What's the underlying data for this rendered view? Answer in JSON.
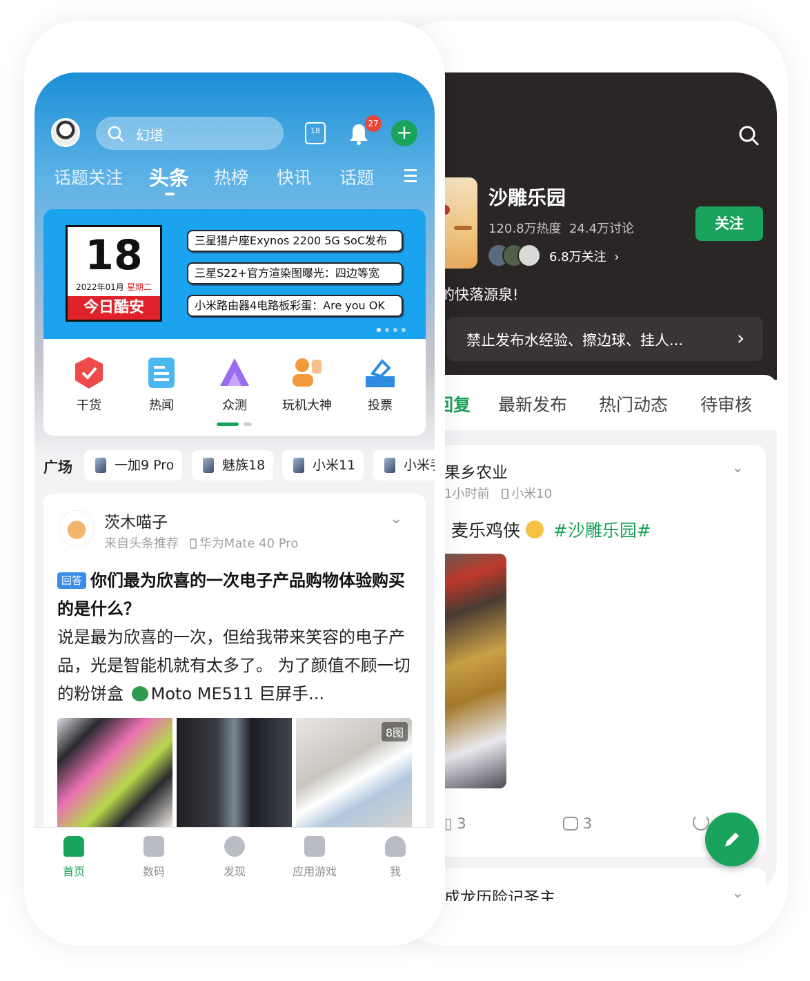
{
  "front": {
    "search_placeholder": "幻塔",
    "notification_badge": "27",
    "calendar_icon_day": "18",
    "tabs": [
      "话题关注",
      "头条",
      "热榜",
      "快讯",
      "话题"
    ],
    "banner": {
      "day": "18",
      "date": "2022年01月",
      "weekday": "星期二",
      "brand": "今日酷安",
      "headlines": [
        "三星猎户座Exynos 2200 5G SoC发布",
        "三星S22+官方渲染图曝光：四边等宽",
        "小米路由器4电路板彩蛋：Are you OK"
      ]
    },
    "quick_entries": [
      "干货",
      "热闻",
      "众测",
      "玩机大神",
      "投票"
    ],
    "square_label": "广场",
    "square_chips": [
      "一加9 Pro",
      "魅族18",
      "小米11",
      "小米手"
    ],
    "post": {
      "author": "茨木喵子",
      "source": "来自头条推荐",
      "device": "华为Mate 40 Pro",
      "tag": "回答",
      "title": "你们最为欣喜的一次电子产品购物体验购买的是什么？",
      "body": "说是最为欣喜的一次，但给我带来笑容的电子产品，光是智能机就有太多了。 为了颜值不顾一切的粉饼盒",
      "body_tail": "Moto ME511 巨屏手...",
      "image_count": "8图"
    },
    "bottom_nav": [
      "首页",
      "数码",
      "发现",
      "应用游戏",
      "我"
    ],
    "colors": {
      "accent": "#1aa35a",
      "banner_blue": "#1aa3ef",
      "tag_blue": "#3a8ee6"
    }
  },
  "back": {
    "group_name": "沙雕乐园",
    "stats": "120.8万热度  24.4万讨论",
    "followers": "6.8万关注",
    "follow_button": "关注",
    "slogan": "的快落源泉!",
    "notice": "禁止发布水经验、擦边球、挂人...",
    "tabs": [
      "回复",
      "最新发布",
      "热门动态",
      "待审核"
    ],
    "post": {
      "author": "果乡农业",
      "time": "1小时前",
      "device": "小米10",
      "text": "麦乐鸡侠",
      "hashtag": "#沙雕乐园#",
      "likes": "3",
      "comments": "3"
    },
    "next_post_author": "成龙历险记圣主"
  }
}
